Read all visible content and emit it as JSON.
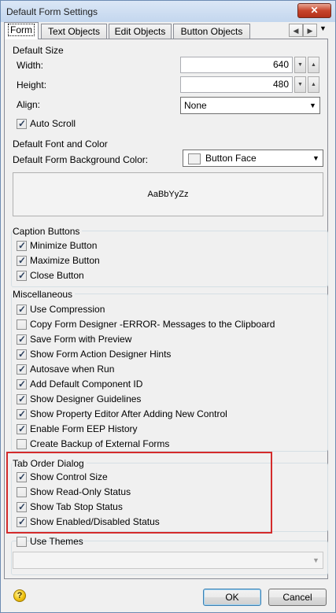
{
  "window": {
    "title": "Default Form Settings",
    "close_glyph": "✕"
  },
  "tabs": [
    "Form",
    "Text Objects",
    "Edit Objects",
    "Button Objects"
  ],
  "default_size": {
    "title": "Default Size",
    "width_label": "Width:",
    "width_value": "640",
    "height_label": "Height:",
    "height_value": "480",
    "align_label": "Align:",
    "align_value": "None",
    "auto_scroll_label": "Auto Scroll",
    "auto_scroll_checked": true
  },
  "font_color": {
    "title": "Default Font and Color",
    "bg_label": "Default Form Background Color:",
    "bg_value": "Button Face",
    "preview_text": "AaBbYyZz"
  },
  "caption_buttons": {
    "title": "Caption Buttons",
    "items": [
      {
        "label": "Minimize Button",
        "checked": true
      },
      {
        "label": "Maximize Button",
        "checked": true
      },
      {
        "label": "Close Button",
        "checked": true
      }
    ]
  },
  "misc": {
    "title": "Miscellaneous",
    "items": [
      {
        "label": "Use Compression",
        "checked": true
      },
      {
        "label": "Copy Form Designer -ERROR- Messages to the Clipboard",
        "checked": false
      },
      {
        "label": "Save Form with Preview",
        "checked": true
      },
      {
        "label": "Show Form Action Designer Hints",
        "checked": true
      },
      {
        "label": "Autosave when Run",
        "checked": true
      },
      {
        "label": "Add Default Component ID",
        "checked": true
      },
      {
        "label": "Show Designer Guidelines",
        "checked": true
      },
      {
        "label": "Show Property Editor After Adding New Control",
        "checked": true
      },
      {
        "label": "Enable Form EEP History",
        "checked": true
      },
      {
        "label": "Create Backup of External Forms",
        "checked": false
      }
    ]
  },
  "tab_order": {
    "title": "Tab Order Dialog",
    "items": [
      {
        "label": "Show Control Size",
        "checked": true
      },
      {
        "label": "Show Read-Only Status",
        "checked": false
      },
      {
        "label": "Show Tab Stop Status",
        "checked": true
      },
      {
        "label": "Show Enabled/Disabled Status",
        "checked": true
      }
    ]
  },
  "themes": {
    "label": "Use Themes",
    "checked": false,
    "value": ""
  },
  "buttons": {
    "ok": "OK",
    "cancel": "Cancel",
    "help_glyph": "?"
  },
  "colors": {
    "highlight": "#d42b2b",
    "close": "#c7452c"
  }
}
